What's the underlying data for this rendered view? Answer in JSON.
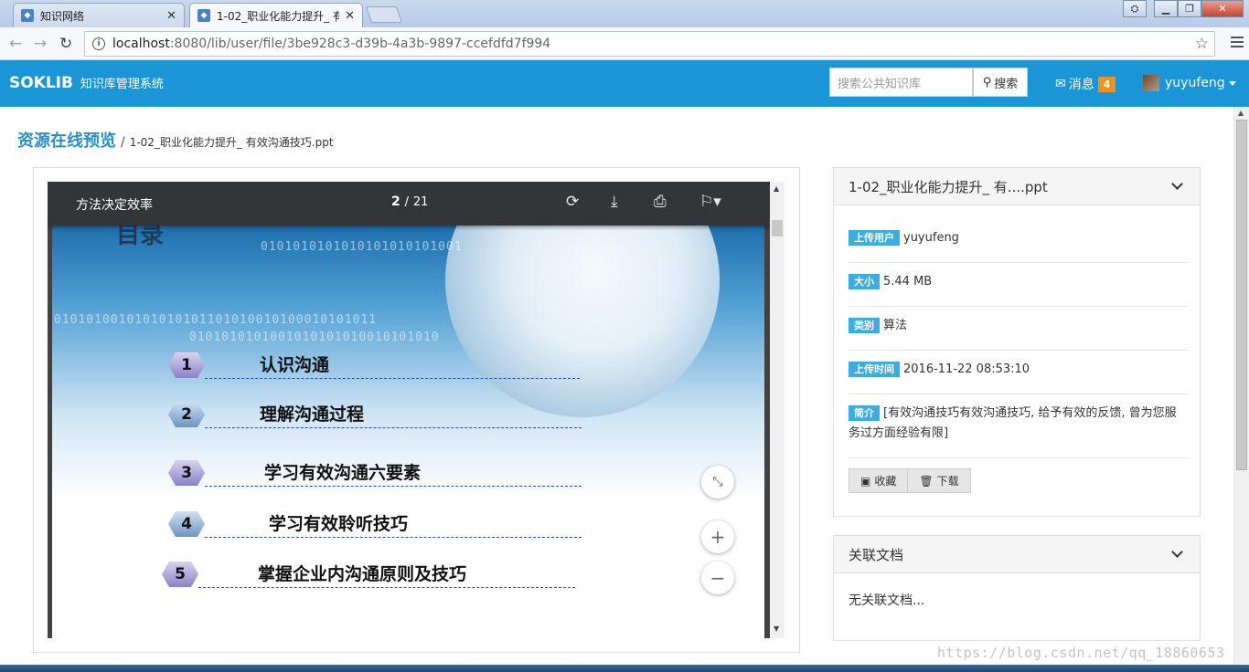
{
  "browser": {
    "tabs": [
      {
        "label": "知识网络",
        "favicon": "page-favicon"
      },
      {
        "label": "1-02_职业化能力提升_ 有",
        "favicon": "page-favicon"
      }
    ],
    "url_host": "localhost",
    "url_path": ":8080/lib/user/file/3be928c3-d39b-4a3b-9897-ccefdfd7f994"
  },
  "app": {
    "brand": "SOKLIB",
    "brand_sub": "知识库管理系统",
    "search_placeholder": "搜索公共知识库",
    "search_button": "搜索",
    "messages_label": "消息",
    "messages_count": "4",
    "username": "yuyufeng",
    "accent_color": "#1a96d7"
  },
  "breadcrumb": {
    "title": "资源在线预览",
    "separator": "/",
    "file": "1-02_职业化能力提升_ 有效沟通技巧.ppt"
  },
  "viewer": {
    "doc_title": "方法决定效率",
    "current_page": "2",
    "page_sep": "/",
    "total_pages": "21",
    "slide": {
      "heading": "目录",
      "binary_lines": [
        "0101010101010101010101001",
        "0101010010101010101101010010100010101011",
        "0101010101001010101010010101010"
      ],
      "items": [
        {
          "num": "1",
          "text": "认识沟通"
        },
        {
          "num": "2",
          "text": "理解沟通过程"
        },
        {
          "num": "3",
          "text": "学习有效沟通六要素"
        },
        {
          "num": "4",
          "text": "学习有效聆听技巧"
        },
        {
          "num": "5",
          "text": "掌握企业内沟通原则及技巧"
        }
      ]
    }
  },
  "info_panel": {
    "title": "1-02_职业化能力提升_ 有....ppt",
    "rows": [
      {
        "tag": "上传用户",
        "value": "yuyufeng"
      },
      {
        "tag": "大小",
        "value": "5.44 MB"
      },
      {
        "tag": "类别",
        "value": "算法"
      },
      {
        "tag": "上传时间",
        "value": "2016-11-22 08:53:10"
      },
      {
        "tag": "简介",
        "value": "[有效沟通技巧有效沟通技巧, 给予有效的反馈, 曾为您服务过方面经验有限]"
      }
    ],
    "favorite_button": "收藏",
    "download_button": "下载"
  },
  "related_panel": {
    "title": "关联文档",
    "empty_text": "无关联文档..."
  },
  "watermark": "https://blog.csdn.net/qq_18860653"
}
